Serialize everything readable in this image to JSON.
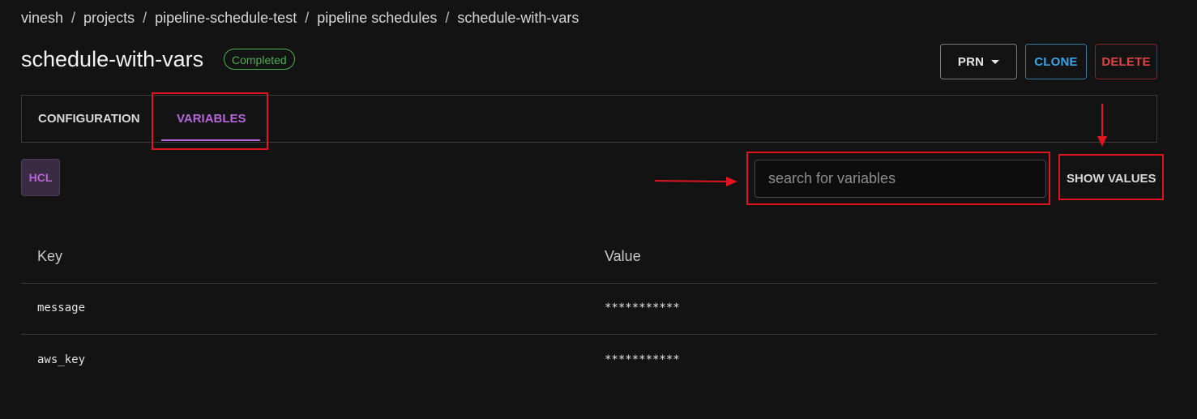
{
  "breadcrumb": [
    "vinesh",
    "projects",
    "pipeline-schedule-test",
    "pipeline schedules",
    "schedule-with-vars"
  ],
  "breadcrumb_separator": "/",
  "page": {
    "title": "schedule-with-vars",
    "status": "Completed"
  },
  "actions": {
    "prn_label": "PRN",
    "clone_label": "CLONE",
    "delete_label": "DELETE"
  },
  "tabs": [
    {
      "label": "CONFIGURATION",
      "active": false
    },
    {
      "label": "VARIABLES",
      "active": true
    }
  ],
  "toolbar": {
    "format_label": "HCL",
    "search_placeholder": "search for variables",
    "search_value": "",
    "show_values_label": "SHOW VALUES"
  },
  "table": {
    "columns": [
      "Key",
      "Value"
    ],
    "rows": [
      {
        "key": "message",
        "value": "***********"
      },
      {
        "key": "aws_key",
        "value": "***********"
      }
    ]
  },
  "colors": {
    "background": "#131313",
    "accent": "#b466d9",
    "status_green": "#4caf50",
    "clone_blue": "#3aa5e6",
    "delete_red": "#e04444",
    "annotation_red": "#e0141e"
  }
}
